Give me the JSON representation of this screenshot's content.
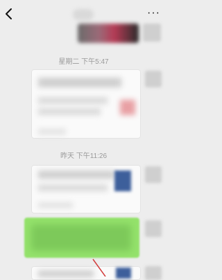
{
  "header": {
    "back_icon": "back-chevron-icon",
    "more_label": "···"
  },
  "messages": {
    "timestamp_1": "星期二 下午5:47",
    "timestamp_2": "昨天 下午11:26"
  },
  "colors": {
    "sent_bubble": "#94e26b",
    "background": "#ededed",
    "annotation_arrow": "#d23a3a"
  }
}
